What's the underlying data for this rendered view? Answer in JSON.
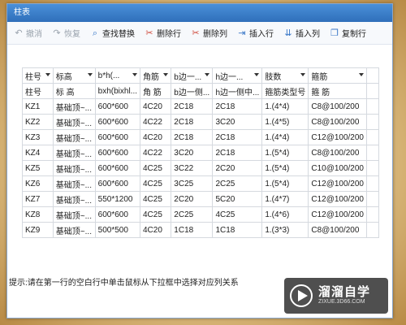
{
  "window": {
    "title": "柱表"
  },
  "toolbar": [
    {
      "label": "撤消",
      "icon": "undo-icon",
      "glyph": "↶",
      "disabled": true,
      "cls": "ico-gray"
    },
    {
      "label": "恢复",
      "icon": "redo-icon",
      "glyph": "↷",
      "disabled": true,
      "cls": "ico-gray"
    },
    {
      "label": "查找替换",
      "icon": "find-replace-icon",
      "glyph": "⌕",
      "disabled": false,
      "cls": "ico-blue"
    },
    {
      "label": "删除行",
      "icon": "delete-row-icon",
      "glyph": "✂",
      "disabled": false,
      "cls": "ico-red"
    },
    {
      "label": "删除列",
      "icon": "delete-column-icon",
      "glyph": "✂",
      "disabled": false,
      "cls": "ico-red"
    },
    {
      "label": "插入行",
      "icon": "insert-row-icon",
      "glyph": "⇥",
      "disabled": false,
      "cls": "ico-blue"
    },
    {
      "label": "插入列",
      "icon": "insert-column-icon",
      "glyph": "⇊",
      "disabled": false,
      "cls": "ico-blue"
    },
    {
      "label": "复制行",
      "icon": "copy-row-icon",
      "glyph": "❐",
      "disabled": false,
      "cls": "ico-blue"
    }
  ],
  "table": {
    "dropdown_headers": [
      "柱号",
      "标高",
      "b*h(...",
      "角筋",
      "b边一...",
      "h边一...",
      "肢数",
      "箍筋",
      ""
    ],
    "mapping_row": [
      "柱号",
      "标 高",
      "bxh(bixhl...",
      "角 筋",
      "b边一侧...",
      "h边一侧中...",
      "箍筋类型号",
      "箍 筋",
      ""
    ],
    "rows": [
      [
        "KZ1",
        "基础顶~...",
        "600*600",
        "4C20",
        "2C18",
        "2C18",
        "1.(4*4)",
        "C8@100/200",
        ""
      ],
      [
        "KZ2",
        "基础顶~...",
        "600*600",
        "4C22",
        "2C18",
        "3C20",
        "1.(4*5)",
        "C8@100/200",
        ""
      ],
      [
        "KZ3",
        "基础顶~...",
        "600*600",
        "4C20",
        "2C18",
        "2C18",
        "1.(4*4)",
        "C12@100/200",
        ""
      ],
      [
        "KZ4",
        "基础顶~...",
        "600*600",
        "4C22",
        "3C20",
        "2C18",
        "1.(5*4)",
        "C8@100/200",
        ""
      ],
      [
        "KZ5",
        "基础顶~...",
        "600*600",
        "4C25",
        "3C22",
        "2C20",
        "1.(5*4)",
        "C10@100/200",
        ""
      ],
      [
        "KZ6",
        "基础顶~...",
        "600*600",
        "4C25",
        "3C25",
        "2C25",
        "1.(5*4)",
        "C12@100/200",
        ""
      ],
      [
        "KZ7",
        "基础顶~...",
        "550*1200",
        "4C25",
        "2C20",
        "5C20",
        "1.(4*7)",
        "C12@100/200",
        ""
      ],
      [
        "KZ8",
        "基础顶~...",
        "600*600",
        "4C25",
        "2C25",
        "4C25",
        "1.(4*6)",
        "C12@100/200",
        ""
      ],
      [
        "KZ9",
        "基础顶~...",
        "500*500",
        "4C20",
        "1C18",
        "1C18",
        "1.(3*3)",
        "C8@100/200",
        ""
      ]
    ]
  },
  "status": {
    "text": "提示:请在第一行的空白行中单击鼠标从下拉框中选择对应列关系"
  },
  "watermark": {
    "name": "溜溜自学",
    "url": "ZIXUE.3D66.COM"
  }
}
